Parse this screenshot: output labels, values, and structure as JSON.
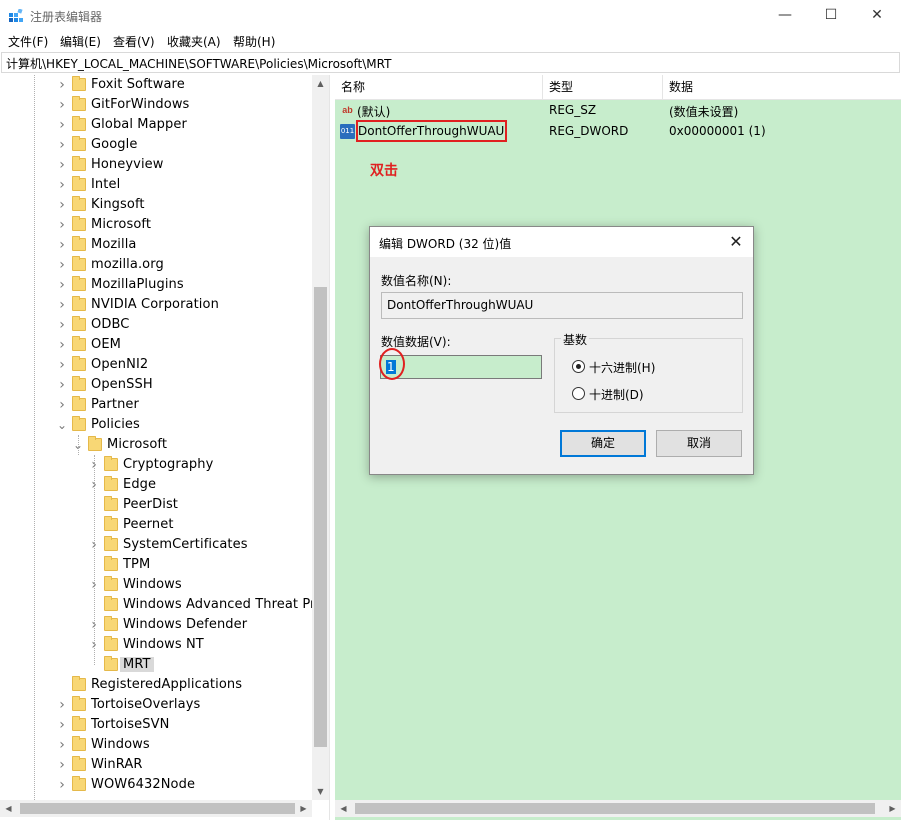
{
  "window": {
    "title": "注册表编辑器",
    "minimize_glyph": "—",
    "maximize_glyph": "☐",
    "close_glyph": "✕"
  },
  "menu": [
    "文件(F)",
    "编辑(E)",
    "查看(V)",
    "收藏夹(A)",
    "帮助(H)"
  ],
  "address": "计算机\\HKEY_LOCAL_MACHINE\\SOFTWARE\\Policies\\Microsoft\\MRT",
  "tree": {
    "items": [
      {
        "label": "Foxit Software",
        "depth": 0,
        "expandable": true
      },
      {
        "label": "GitForWindows",
        "depth": 0,
        "expandable": true
      },
      {
        "label": "Global Mapper",
        "depth": 0,
        "expandable": true
      },
      {
        "label": "Google",
        "depth": 0,
        "expandable": true
      },
      {
        "label": "Honeyview",
        "depth": 0,
        "expandable": true
      },
      {
        "label": "Intel",
        "depth": 0,
        "expandable": true
      },
      {
        "label": "Kingsoft",
        "depth": 0,
        "expandable": true
      },
      {
        "label": "Microsoft",
        "depth": 0,
        "expandable": true
      },
      {
        "label": "Mozilla",
        "depth": 0,
        "expandable": true
      },
      {
        "label": "mozilla.org",
        "depth": 0,
        "expandable": true
      },
      {
        "label": "MozillaPlugins",
        "depth": 0,
        "expandable": true
      },
      {
        "label": "NVIDIA Corporation",
        "depth": 0,
        "expandable": true
      },
      {
        "label": "ODBC",
        "depth": 0,
        "expandable": true
      },
      {
        "label": "OEM",
        "depth": 0,
        "expandable": true
      },
      {
        "label": "OpenNI2",
        "depth": 0,
        "expandable": true
      },
      {
        "label": "OpenSSH",
        "depth": 0,
        "expandable": true
      },
      {
        "label": "Partner",
        "depth": 0,
        "expandable": true
      },
      {
        "label": "Policies",
        "depth": 0,
        "expandable": true,
        "expanded": true
      },
      {
        "label": "Microsoft",
        "depth": 1,
        "expandable": true,
        "expanded": true
      },
      {
        "label": "Cryptography",
        "depth": 2,
        "expandable": true
      },
      {
        "label": "Edge",
        "depth": 2,
        "expandable": true
      },
      {
        "label": "PeerDist",
        "depth": 2,
        "expandable": false
      },
      {
        "label": "Peernet",
        "depth": 2,
        "expandable": false
      },
      {
        "label": "SystemCertificates",
        "depth": 2,
        "expandable": true
      },
      {
        "label": "TPM",
        "depth": 2,
        "expandable": false
      },
      {
        "label": "Windows",
        "depth": 2,
        "expandable": true
      },
      {
        "label": "Windows Advanced Threat Prote",
        "depth": 2,
        "expandable": false
      },
      {
        "label": "Windows Defender",
        "depth": 2,
        "expandable": true
      },
      {
        "label": "Windows NT",
        "depth": 2,
        "expandable": true
      },
      {
        "label": "MRT",
        "depth": 2,
        "expandable": false,
        "selected": true
      },
      {
        "label": "RegisteredApplications",
        "depth": 0,
        "expandable": false
      },
      {
        "label": "TortoiseOverlays",
        "depth": 0,
        "expandable": true
      },
      {
        "label": "TortoiseSVN",
        "depth": 0,
        "expandable": true
      },
      {
        "label": "Windows",
        "depth": 0,
        "expandable": true
      },
      {
        "label": "WinRAR",
        "depth": 0,
        "expandable": true
      },
      {
        "label": "WOW6432Node",
        "depth": 0,
        "expandable": true
      }
    ]
  },
  "values": {
    "headers": {
      "name": "名称",
      "type": "类型",
      "data": "数据"
    },
    "rows": [
      {
        "icon": "ab",
        "icon_text": "ab",
        "name": "(默认)",
        "type": "REG_SZ",
        "data": "(数值未设置)"
      },
      {
        "icon": "bin",
        "icon_text": "011",
        "name": "DontOfferThroughWUAU",
        "type": "REG_DWORD",
        "data": "0x00000001 (1)"
      }
    ],
    "background_color": "#c7edcc"
  },
  "annotation": {
    "text": "双击",
    "color": "#e02020"
  },
  "dialog": {
    "title": "编辑 DWORD (32 位)值",
    "name_label": "数值名称(N):",
    "name_value": "DontOfferThroughWUAU",
    "data_label": "数值数据(V):",
    "data_value": "1",
    "radix_label": "基数",
    "radix_options": [
      {
        "label": "十六进制(H)",
        "checked": true
      },
      {
        "label": "十进制(D)",
        "checked": false
      }
    ],
    "ok_label": "确定",
    "cancel_label": "取消",
    "close_glyph": "✕"
  },
  "scroll_arrows": {
    "up": "▲",
    "down": "▼",
    "left": "◀",
    "right": "▶"
  },
  "accent_color": "#0078d7"
}
